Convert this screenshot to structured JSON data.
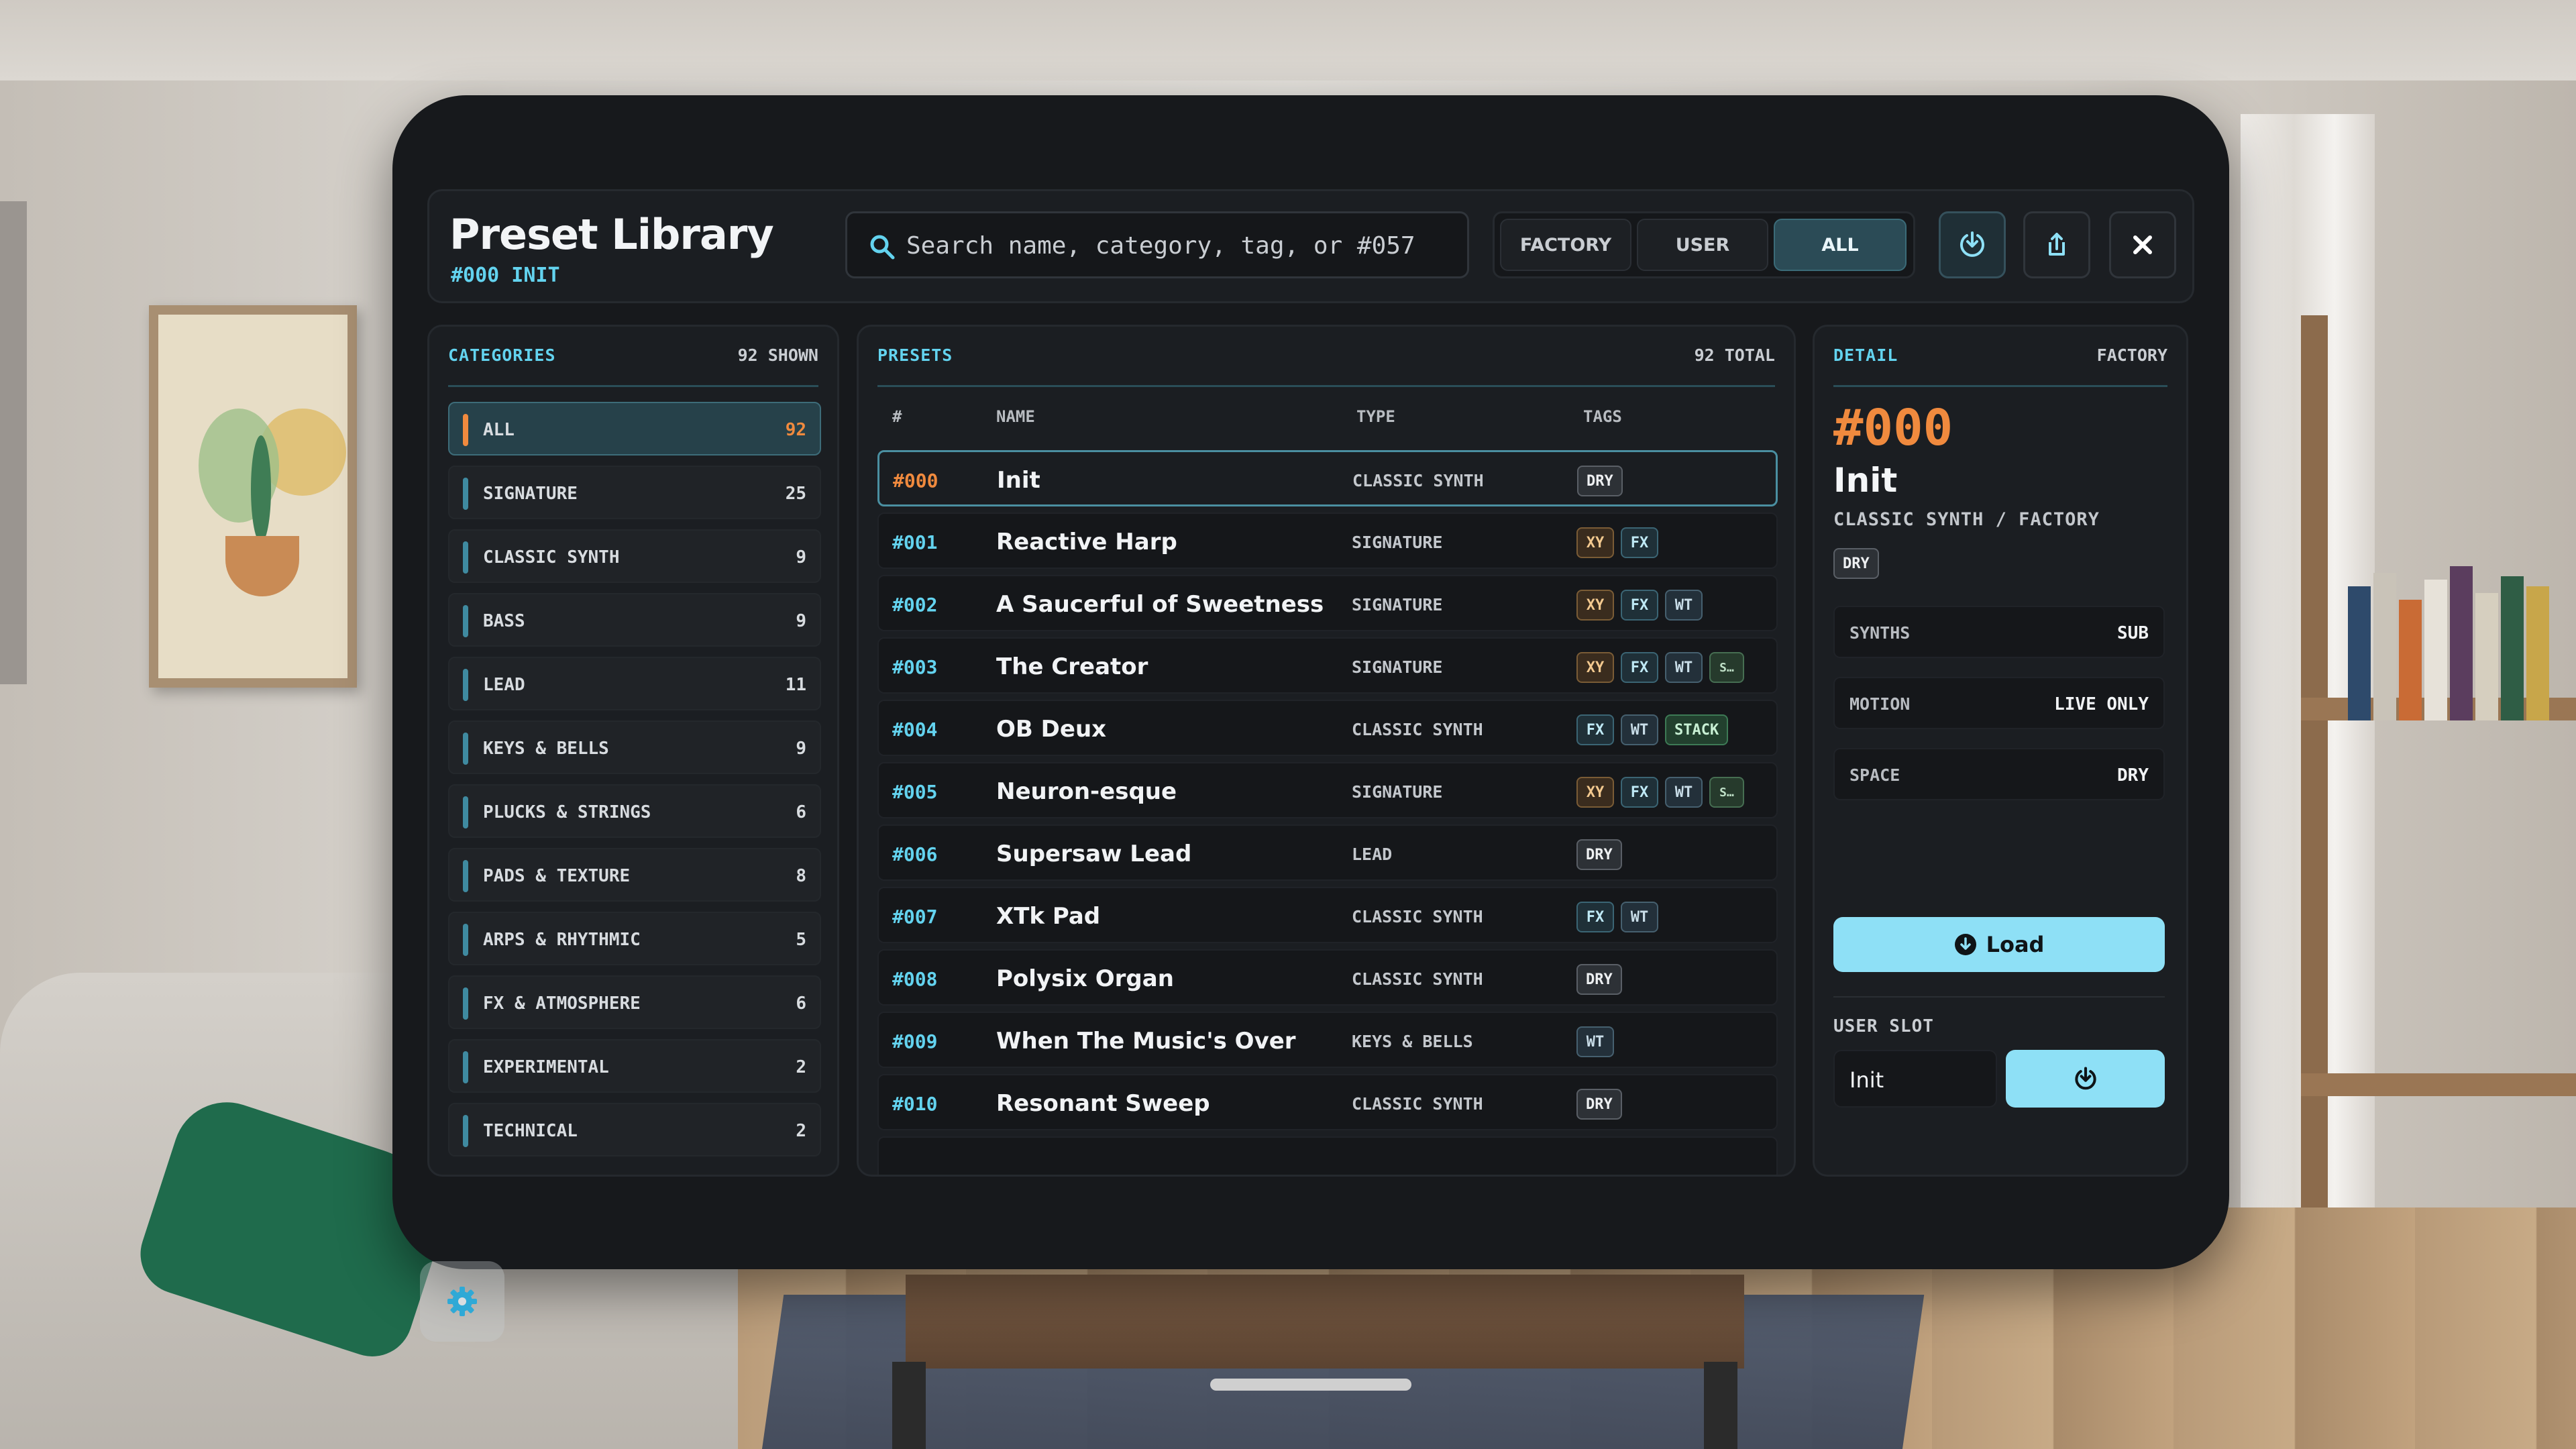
{
  "header": {
    "title": "Preset Library",
    "subtitle": "#000 INIT",
    "search_placeholder": "Search name, category, tag, or #057",
    "filters": [
      {
        "label": "FACTORY",
        "active": false
      },
      {
        "label": "USER",
        "active": false
      },
      {
        "label": "ALL",
        "active": true
      }
    ],
    "icons": [
      "save-icon",
      "share-icon",
      "close-icon"
    ]
  },
  "categories": {
    "title": "CATEGORIES",
    "shown": "92 SHOWN",
    "items": [
      {
        "label": "ALL",
        "count": "92",
        "active": true
      },
      {
        "label": "SIGNATURE",
        "count": "25"
      },
      {
        "label": "CLASSIC SYNTH",
        "count": "9"
      },
      {
        "label": "BASS",
        "count": "9"
      },
      {
        "label": "LEAD",
        "count": "11"
      },
      {
        "label": "KEYS & BELLS",
        "count": "9"
      },
      {
        "label": "PLUCKS & STRINGS",
        "count": "6"
      },
      {
        "label": "PADS & TEXTURE",
        "count": "8"
      },
      {
        "label": "ARPS & RHYTHMIC",
        "count": "5"
      },
      {
        "label": "FX & ATMOSPHERE",
        "count": "6"
      },
      {
        "label": "EXPERIMENTAL",
        "count": "2"
      },
      {
        "label": "TECHNICAL",
        "count": "2"
      }
    ]
  },
  "presets": {
    "title": "PRESETS",
    "total": "92 TOTAL",
    "columns": {
      "num": "#",
      "name": "NAME",
      "type": "TYPE",
      "tags": "TAGS"
    },
    "rows": [
      {
        "num": "#000",
        "name": "Init",
        "type": "CLASSIC SYNTH",
        "tags": [
          "DRY"
        ],
        "selected": true
      },
      {
        "num": "#001",
        "name": "Reactive Harp",
        "type": "SIGNATURE",
        "tags": [
          "XY",
          "FX"
        ]
      },
      {
        "num": "#002",
        "name": "A Saucerful of Sweetness",
        "type": "SIGNATURE",
        "tags": [
          "XY",
          "FX",
          "WT"
        ]
      },
      {
        "num": "#003",
        "name": "The Creator",
        "type": "SIGNATURE",
        "tags": [
          "XY",
          "FX",
          "WT",
          "S…"
        ]
      },
      {
        "num": "#004",
        "name": "OB Deux",
        "type": "CLASSIC SYNTH",
        "tags": [
          "FX",
          "WT",
          "STACK"
        ]
      },
      {
        "num": "#005",
        "name": "Neuron-esque",
        "type": "SIGNATURE",
        "tags": [
          "XY",
          "FX",
          "WT",
          "S…"
        ]
      },
      {
        "num": "#006",
        "name": "Supersaw Lead",
        "type": "LEAD",
        "tags": [
          "DRY"
        ]
      },
      {
        "num": "#007",
        "name": "XTk Pad",
        "type": "CLASSIC SYNTH",
        "tags": [
          "FX",
          "WT"
        ]
      },
      {
        "num": "#008",
        "name": "Polysix Organ",
        "type": "CLASSIC SYNTH",
        "tags": [
          "DRY"
        ]
      },
      {
        "num": "#009",
        "name": "When The Music's Over",
        "type": "KEYS & BELLS",
        "tags": [
          "WT"
        ]
      },
      {
        "num": "#010",
        "name": "Resonant Sweep",
        "type": "CLASSIC SYNTH",
        "tags": [
          "DRY"
        ]
      }
    ]
  },
  "detail": {
    "title": "DETAIL",
    "source": "FACTORY",
    "num": "#000",
    "name": "Init",
    "meta": "CLASSIC SYNTH / FACTORY",
    "tag": "DRY",
    "props": [
      {
        "key": "SYNTHS",
        "value": "SUB"
      },
      {
        "key": "MOTION",
        "value": "LIVE ONLY"
      },
      {
        "key": "SPACE",
        "value": "DRY"
      }
    ],
    "load_label": "Load",
    "user_slot_label": "USER SLOT",
    "user_slot_value": "Init"
  },
  "colors": {
    "accent_cyan": "#63d3ef",
    "accent_orange": "#f08a3e",
    "button_cyan": "#8ee0f6",
    "window_bg": "#17191c"
  }
}
